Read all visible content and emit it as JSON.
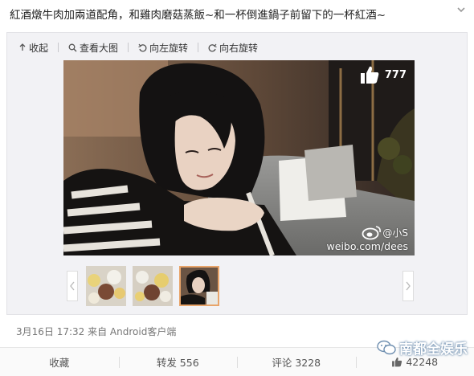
{
  "post": {
    "text": "紅酒燉牛肉加兩道配角，和雞肉磨菇蒸飯~和一杯倒進鍋子前留下的一杯紅酒~"
  },
  "toolbar": {
    "collapse_label": "收起",
    "view_large_label": "查看大图",
    "rotate_left_label": "向左旋转",
    "rotate_right_label": "向右旋转"
  },
  "photo": {
    "like_count": "777",
    "watermark_user": "@小S",
    "watermark_url": "weibo.com/dees"
  },
  "meta": {
    "timestamp_source": "3月16日  17:32 来自 Android客户端"
  },
  "actions": {
    "favorite_label": "收藏",
    "repost_label": "转发 556",
    "comment_label": "评论 3228",
    "like_count": "42248"
  },
  "brand": {
    "name": "南都全娱乐"
  },
  "colors": {
    "accent": "#e8a46a",
    "brand_outline": "#6f8fb0"
  },
  "icons": [
    "chevron-down-icon",
    "collapse-icon",
    "zoom-icon",
    "rotate-left-icon",
    "rotate-right-icon",
    "thumbs-up-icon",
    "weibo-icon",
    "chevron-left-icon",
    "chevron-right-icon",
    "wechat-icon"
  ]
}
